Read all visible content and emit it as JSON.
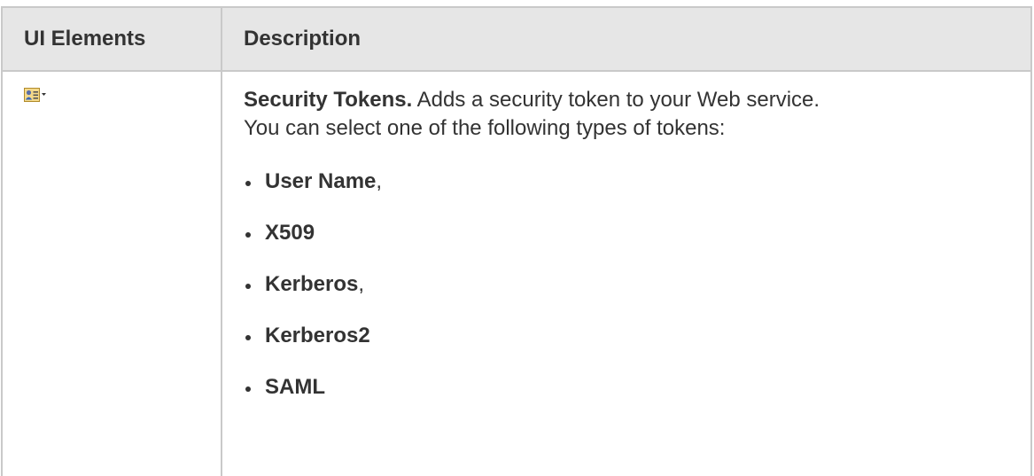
{
  "table": {
    "header_ui": "UI Elements",
    "header_desc": "Description"
  },
  "row": {
    "icon": "security-tokens-icon",
    "title": "Security Tokens.",
    "text_line1": " Adds a security token to your Web service.",
    "text_line2": "You can select one of the following types of tokens:",
    "items": [
      {
        "name": "User Name",
        "suffix": ","
      },
      {
        "name": "X509",
        "suffix": ""
      },
      {
        "name": "Kerberos",
        "suffix": ","
      },
      {
        "name": "Kerberos2",
        "suffix": ""
      },
      {
        "name": "SAML",
        "suffix": ""
      }
    ]
  },
  "colors": {
    "header_bg": "#e6e6e6",
    "border": "#c9c9c9",
    "text": "#333333"
  }
}
